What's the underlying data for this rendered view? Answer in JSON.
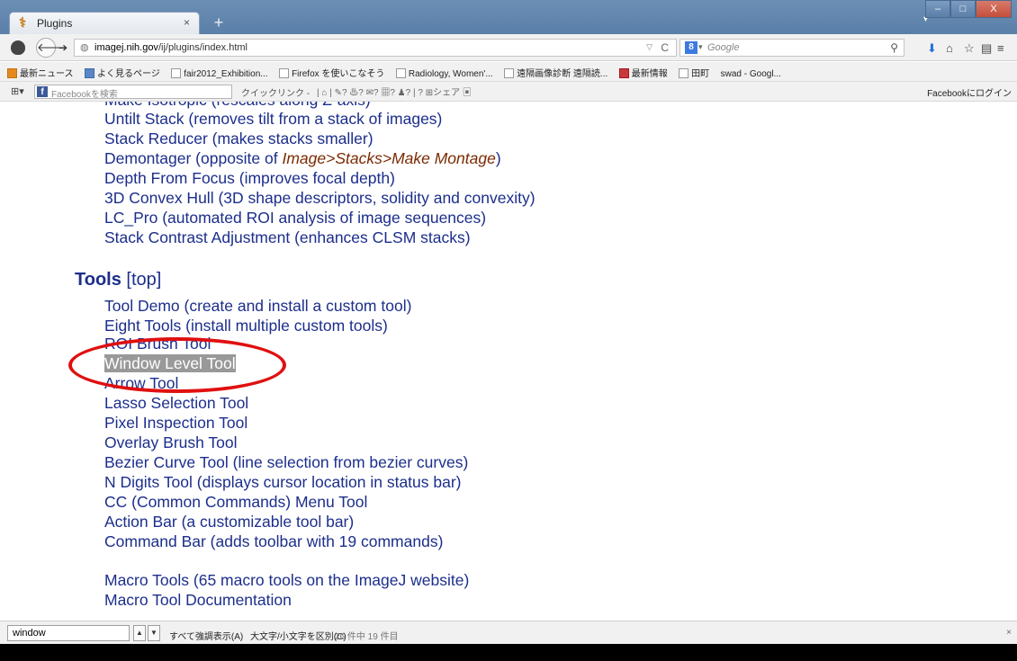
{
  "browser": {
    "tab_title": "Plugins",
    "tab_close": "×",
    "new_tab": "+",
    "url_domain": "imagej.nih.gov",
    "url_path": "/ij/plugins/index.html",
    "search_placeholder": "Google"
  },
  "bookmarks": [
    {
      "label": "最新ニュース",
      "icon": "rss-icon"
    },
    {
      "label": "よく見るページ",
      "icon": "page-icon"
    },
    {
      "label": "fair2012_Exhibition...",
      "icon": "bookmark-icon"
    },
    {
      "label": "Firefox を使いこなそう",
      "icon": "bookmark-icon"
    },
    {
      "label": "Radiology, Women'...",
      "icon": "bookmark-icon"
    },
    {
      "label": "遠隔画像診断 遠隔読...",
      "icon": "bookmark-icon"
    },
    {
      "label": "最新情報",
      "icon": "news-icon"
    },
    {
      "label": "田町",
      "icon": "bookmark-icon"
    },
    {
      "label": "swad - Googl...",
      "icon": "none"
    }
  ],
  "fbbar": {
    "search_placeholder": "Facebookを検索",
    "quicklink": "クイックリンク -",
    "share": "シェア",
    "login": "Facebookにログイン"
  },
  "content": {
    "partial_top": "Make Isotropic (rescales along Z-axis)",
    "stack_items": [
      "Untilt Stack (removes tilt from a stack of images)",
      "Stack Reducer (makes stacks smaller)",
      "Depth From Focus (improves focal depth)",
      "3D Convex Hull (3D shape descriptors, solidity and convexity)",
      "LC_Pro (automated ROI analysis of image sequences)",
      "Stack Contrast Adjustment (enhances CLSM stacks)"
    ],
    "demontager_prefix": "Demontager (opposite of ",
    "demontager_em": "Image>Stacks>Make Montage",
    "demontager_suffix": ")",
    "tools_heading": "Tools",
    "top_link": "[top]",
    "tools_items": [
      "Tool Demo (create and install a custom tool)",
      "Eight Tools (install multiple custom tools)",
      "ROI Brush Tool",
      "Window Level Tool",
      "Arrow Tool",
      "Lasso Selection Tool",
      "Pixel Inspection Tool",
      "Overlay Brush Tool",
      "Bezier Curve Tool (line selection from bezier curves)",
      "N Digits Tool (displays cursor location in status bar)",
      "CC (Common Commands) Menu Tool",
      "Action Bar (a customizable tool bar)",
      "Command Bar (adds toolbar with 19 commands)"
    ],
    "macro_items": [
      "Macro Tools (65 macro tools on the ImageJ website)",
      "Macro Tool Documentation"
    ]
  },
  "findbar": {
    "value": "window",
    "highlight_all": "すべて強調表示(A)",
    "match_case": "大文字/小文字を区別(C)",
    "status": "26 件中 19 件目"
  },
  "colors": {
    "link": "#1c2e8c",
    "highlight_bg": "#999999",
    "annotation": "#e01010"
  }
}
